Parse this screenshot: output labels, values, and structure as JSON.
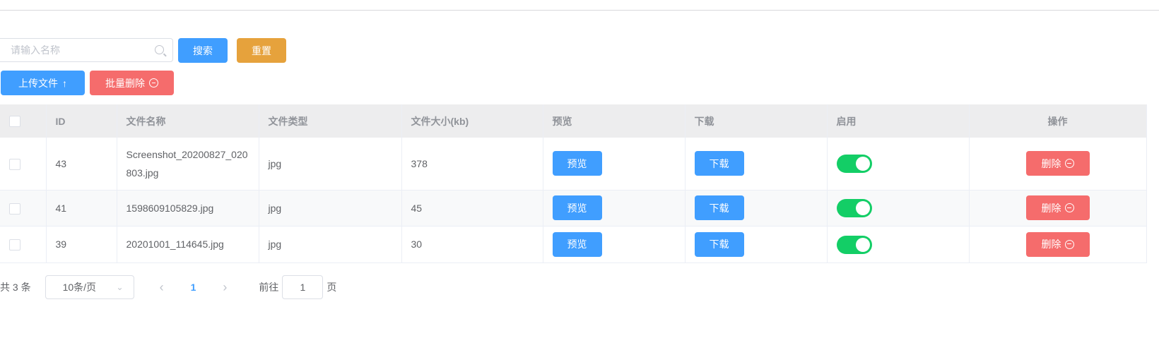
{
  "toolbar": {
    "search_placeholder": "请输入名称",
    "search_value": "",
    "search_label": "搜索",
    "reset_label": "重置",
    "upload_label": "上传文件",
    "batch_delete_label": "批量删除"
  },
  "table": {
    "headers": {
      "id": "ID",
      "name": "文件名称",
      "type": "文件类型",
      "size": "文件大小(kb)",
      "preview": "预览",
      "download": "下载",
      "enabled": "启用",
      "actions": "操作"
    },
    "rows": [
      {
        "id": "43",
        "name": "Screenshot_20200827_020803.jpg",
        "type": "jpg",
        "size": "378",
        "preview": "预览",
        "download": "下载",
        "enabled": true,
        "delete": "删除"
      },
      {
        "id": "41",
        "name": "1598609105829.jpg",
        "type": "jpg",
        "size": "45",
        "preview": "预览",
        "download": "下载",
        "enabled": true,
        "delete": "删除"
      },
      {
        "id": "39",
        "name": "20201001_114645.jpg",
        "type": "jpg",
        "size": "30",
        "preview": "预览",
        "download": "下载",
        "enabled": true,
        "delete": "删除"
      }
    ]
  },
  "pagination": {
    "total": "共 3 条",
    "page_size": "10条/页",
    "current_page": "1",
    "goto_label": "前往",
    "goto_value": "1",
    "page_suffix": "页"
  },
  "colors": {
    "primary": "#409eff",
    "warning": "#e6a23c",
    "danger": "#f56c6c",
    "success": "#13ce66"
  }
}
